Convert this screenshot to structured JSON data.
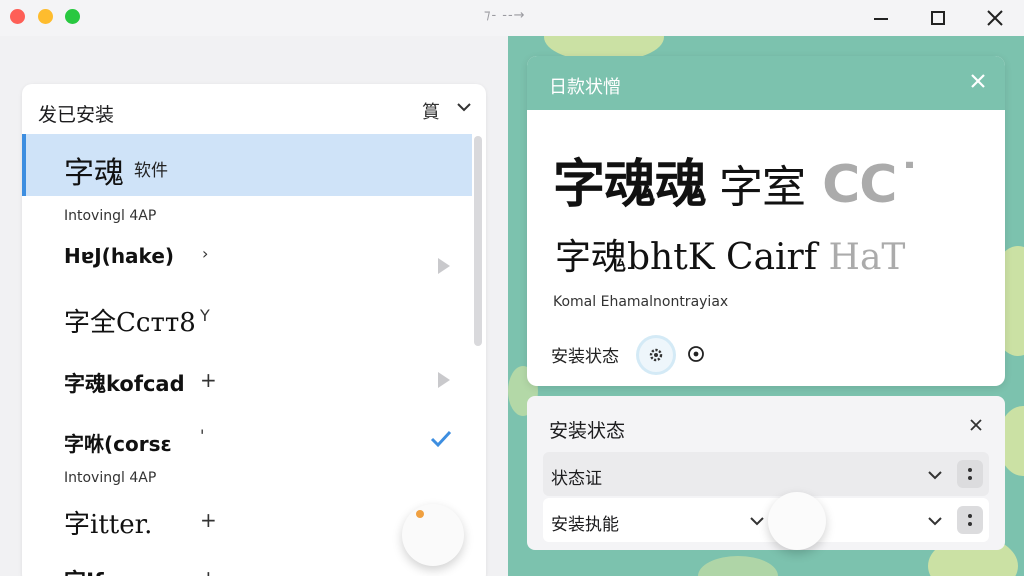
{
  "window": {
    "title_glyph": "⁊- --→"
  },
  "installed": {
    "title": "发已安装",
    "sort_icon": "sort-icon",
    "rows": [
      {
        "name": "字魂",
        "suffix": "软件",
        "selected": true
      },
      {
        "section": "Intovingl 4AP"
      },
      {
        "name": "HɐJ(hake)",
        "mark": "›",
        "arrow": true
      },
      {
        "name": "字全Cᴄᴛᴛ8",
        "mark": "Y"
      },
      {
        "name": "字魂kofcad",
        "mark": "+",
        "arrow": true
      },
      {
        "name": "字咻(corsɛ",
        "mark": "'",
        "checked": true
      },
      {
        "section": "Intovingl 4AP"
      },
      {
        "name": "字itter.",
        "mark": "+"
      },
      {
        "name": "字Ifexs",
        "mark": "+"
      }
    ]
  },
  "details": {
    "title": "日款状憎",
    "preview_bold": "字魂魂",
    "preview_light": " 字室",
    "preview_faded": " CC˙",
    "preview_line2": "字魂bhtK Cairf ",
    "preview_line2_faded": "HaT",
    "sample": "Komal Ehamalnontrayiax",
    "status_label": "安装状态"
  },
  "status_panel": {
    "title": "安装状态",
    "select1_label": "状态证",
    "select2_label": "安装执能"
  },
  "colors": {
    "accent": "#3d8ee0",
    "teal": "#7cc2ae",
    "selection": "#cfe3f8"
  }
}
